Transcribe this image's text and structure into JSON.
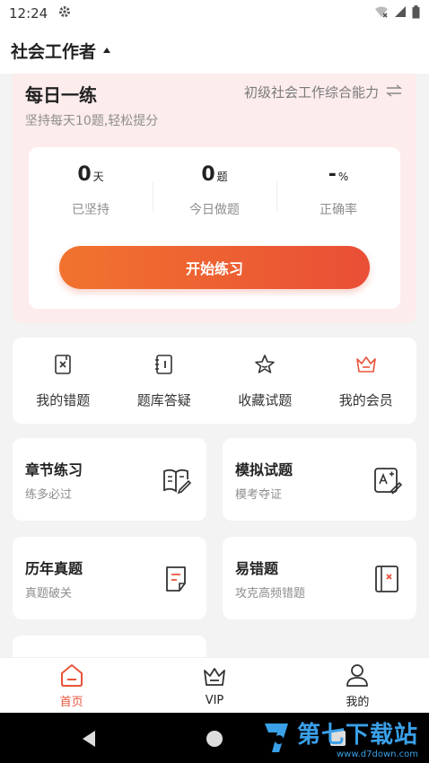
{
  "status_bar": {
    "time": "12:24"
  },
  "header": {
    "title": "社会工作者"
  },
  "daily": {
    "title": "每日一练",
    "subtitle": "坚持每天10题,轻松提分",
    "subject": "初级社会工作综合能力",
    "stats": [
      {
        "value": "0",
        "unit": "天",
        "label": "已坚持"
      },
      {
        "value": "0",
        "unit": "题",
        "label": "今日做题"
      },
      {
        "value": "-",
        "unit": "%",
        "label": "正确率"
      }
    ],
    "start_label": "开始练习"
  },
  "quick_actions": [
    {
      "label": "我的错题",
      "icon": "wrong-questions-icon"
    },
    {
      "label": "题库答疑",
      "icon": "question-bank-icon"
    },
    {
      "label": "收藏试题",
      "icon": "star-icon"
    },
    {
      "label": "我的会员",
      "icon": "crown-icon"
    }
  ],
  "cards": [
    {
      "title": "章节练习",
      "subtitle": "练多必过",
      "icon": "book-edit-icon"
    },
    {
      "title": "模拟试题",
      "subtitle": "模考夺证",
      "icon": "grade-edit-icon"
    },
    {
      "title": "历年真题",
      "subtitle": "真题破关",
      "icon": "document-icon"
    },
    {
      "title": "易错题",
      "subtitle": "攻克高频错题",
      "icon": "wrong-book-icon"
    }
  ],
  "tabs": [
    {
      "label": "首页",
      "active": true
    },
    {
      "label": "VIP",
      "active": false
    },
    {
      "label": "我的",
      "active": false
    }
  ],
  "watermark": {
    "main": "第七下载站",
    "sub": "www.d7down.com"
  },
  "colors": {
    "accent": "#e9533a",
    "accent_start": "#f1732e",
    "daily_bg": "#fdecec"
  }
}
